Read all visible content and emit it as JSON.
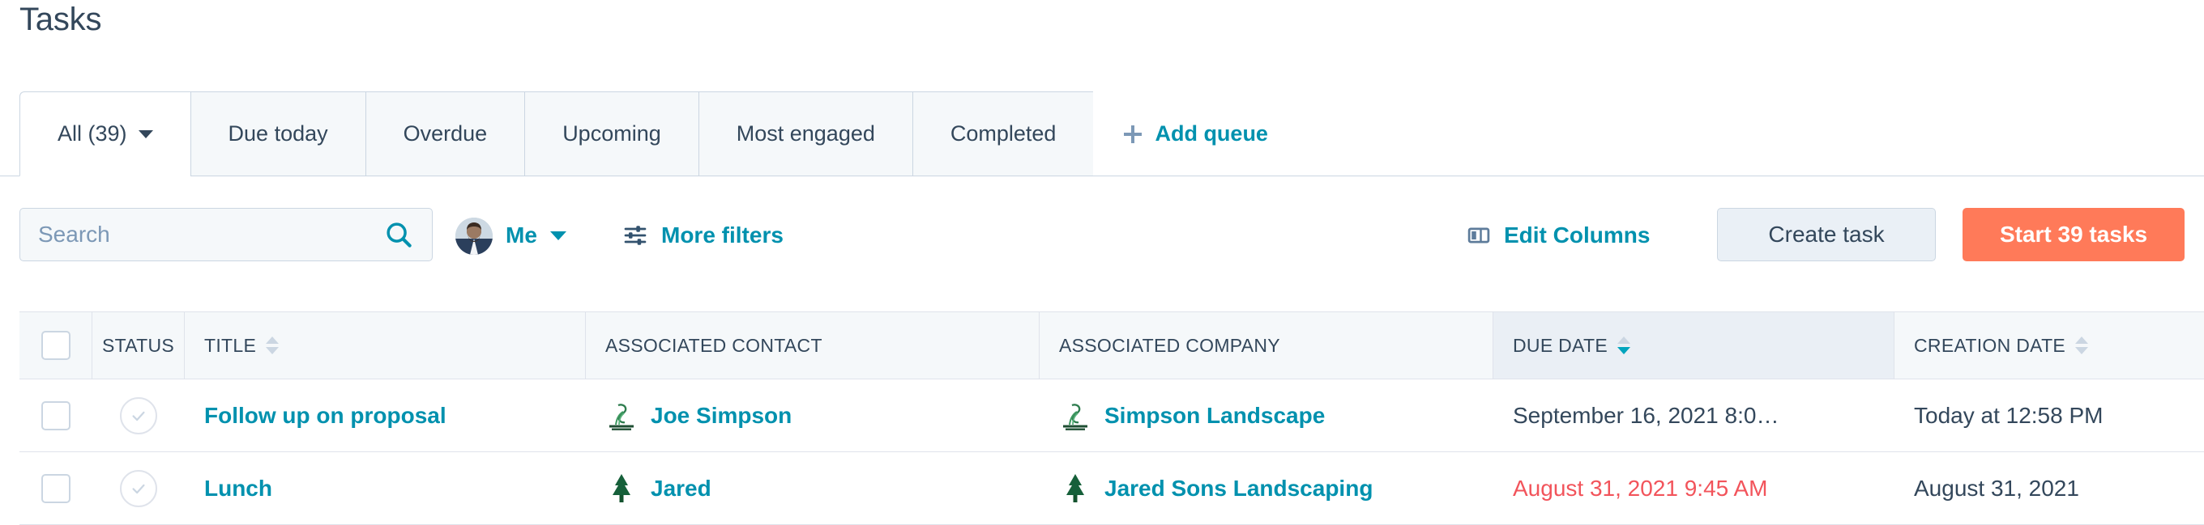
{
  "page": {
    "title": "Tasks"
  },
  "tabs": [
    {
      "label": "All (39)",
      "active": true,
      "has_caret": true
    },
    {
      "label": "Due today",
      "active": false,
      "has_caret": false
    },
    {
      "label": "Overdue",
      "active": false,
      "has_caret": false
    },
    {
      "label": "Upcoming",
      "active": false,
      "has_caret": false
    },
    {
      "label": "Most engaged",
      "active": false,
      "has_caret": false
    },
    {
      "label": "Completed",
      "active": false,
      "has_caret": false
    }
  ],
  "add_queue": {
    "label": "Add queue",
    "icon": "plus-icon"
  },
  "toolbar": {
    "search": {
      "value": "",
      "placeholder": "Search",
      "icon": "search-icon"
    },
    "owner_filter": {
      "label": "Me",
      "icon": "chevron-down-icon",
      "avatar": "user-avatar"
    },
    "more_filters": {
      "label": "More filters",
      "icon": "filters-icon"
    },
    "edit_columns": {
      "label": "Edit Columns",
      "icon": "columns-icon"
    },
    "create_task": {
      "label": "Create task"
    },
    "start_tasks": {
      "label": "Start 39 tasks"
    }
  },
  "table": {
    "columns": [
      {
        "key": "check",
        "label": "",
        "sortable": false
      },
      {
        "key": "status",
        "label": "STATUS",
        "sortable": false
      },
      {
        "key": "title",
        "label": "TITLE",
        "sortable": true,
        "sort": "none"
      },
      {
        "key": "contact",
        "label": "ASSOCIATED CONTACT",
        "sortable": false
      },
      {
        "key": "company",
        "label": "ASSOCIATED COMPANY",
        "sortable": false
      },
      {
        "key": "due",
        "label": "DUE DATE",
        "sortable": true,
        "sort": "desc"
      },
      {
        "key": "created",
        "label": "CREATION DATE",
        "sortable": true,
        "sort": "none"
      }
    ],
    "rows": [
      {
        "title": "Follow up on proposal",
        "contact": "Joe Simpson",
        "company": "Simpson Landscape",
        "contact_logo": "simpson-landscape-logo",
        "company_logo": "simpson-landscape-logo",
        "due_date": "September 16, 2021 8:0…",
        "due_overdue": false,
        "creation_date": "Today at 12:58 PM",
        "status": "incomplete"
      },
      {
        "title": "Lunch",
        "contact": "Jared",
        "company": "Jared Sons Landscaping",
        "contact_logo": "evergreen-logo",
        "company_logo": "evergreen-logo",
        "due_date": "August 31, 2021 9:45 AM",
        "due_overdue": true,
        "creation_date": "August 31, 2021",
        "status": "incomplete"
      }
    ]
  },
  "colors": {
    "brand_orange": "#ff7a59",
    "link_teal": "#0091ae",
    "text_dark": "#33475b",
    "border": "#cbd6e2",
    "overdue_red": "#f2545b",
    "header_bg": "#f5f8fa"
  }
}
